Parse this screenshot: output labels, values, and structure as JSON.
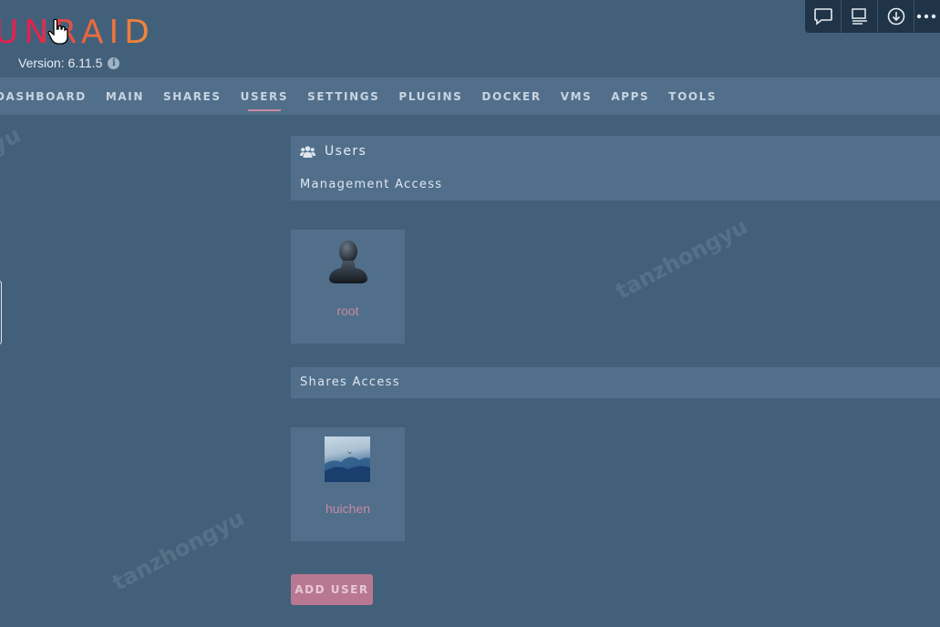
{
  "header": {
    "logo_text": "UNRAID",
    "version_label": "Version: 6.11.5"
  },
  "toolbar": {
    "items": [
      "chat-icon",
      "feed-icon",
      "download-icon",
      "more-icon"
    ]
  },
  "nav": {
    "items": [
      {
        "label": "DASHBOARD"
      },
      {
        "label": "MAIN"
      },
      {
        "label": "SHARES"
      },
      {
        "label": "USERS",
        "active": true
      },
      {
        "label": "SETTINGS"
      },
      {
        "label": "PLUGINS"
      },
      {
        "label": "DOCKER"
      },
      {
        "label": "VMS"
      },
      {
        "label": "APPS"
      },
      {
        "label": "TOOLS"
      }
    ]
  },
  "users_section": {
    "title": "Users",
    "management_label": "Management Access",
    "management_users": [
      {
        "name": "root",
        "avatar": "default-avatar-icon"
      }
    ],
    "shares_label": "Shares Access",
    "share_users": [
      {
        "name": "huichen",
        "avatar": "landscape-photo"
      }
    ]
  },
  "add_user_label": "ADD USER",
  "watermarks": [
    "yu",
    "tanzhongyu",
    "tanzhongyu"
  ],
  "colors": {
    "background": "#43607b",
    "panel": "#516f8b",
    "accent": "#c68aa0",
    "button": "#b87891",
    "logo_start": "#e2224d",
    "logo_end": "#f08a39"
  }
}
